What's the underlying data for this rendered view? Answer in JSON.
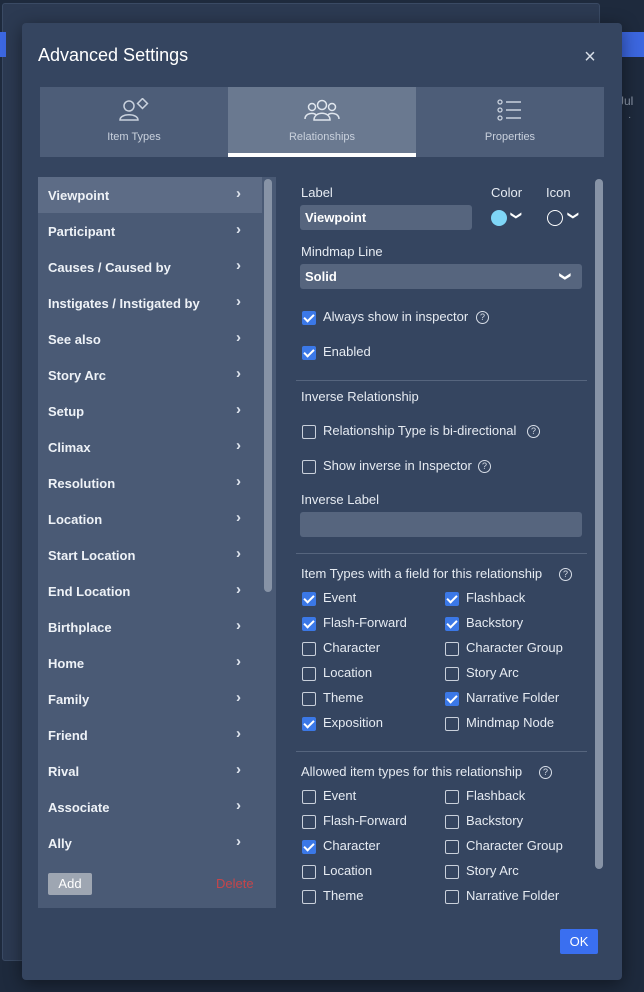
{
  "background": {
    "month_label": "Jul"
  },
  "dialog": {
    "title": "Advanced Settings",
    "close_symbol": "×"
  },
  "tabs": [
    {
      "label": "Item Types",
      "icon": "user-diamond-icon",
      "active": false
    },
    {
      "label": "Relationships",
      "icon": "users-group-icon",
      "active": true
    },
    {
      "label": "Properties",
      "icon": "list-icon",
      "active": false
    }
  ],
  "relationships": [
    "Viewpoint",
    "Participant",
    "Causes / Caused by",
    "Instigates / Instigated by",
    "See also",
    "Story Arc",
    "Setup",
    "Climax",
    "Resolution",
    "Location",
    "Start Location",
    "End Location",
    "Birthplace",
    "Home",
    "Family",
    "Friend",
    "Rival",
    "Associate",
    "Ally"
  ],
  "selected_relationship": "Viewpoint",
  "list_actions": {
    "add": "Add",
    "delete": "Delete"
  },
  "editor": {
    "label_heading": "Label",
    "label_value": "Viewpoint",
    "color_heading": "Color",
    "color_value": "#7fd6f7",
    "icon_heading": "Icon",
    "mindmap_heading": "Mindmap Line",
    "mindmap_value": "Solid",
    "always_show": {
      "label": "Always show in inspector",
      "checked": true
    },
    "enabled": {
      "label": "Enabled",
      "checked": true
    },
    "inverse_heading": "Inverse Relationship",
    "bidirectional": {
      "label": "Relationship Type is bi-directional",
      "checked": false
    },
    "show_inverse": {
      "label": "Show inverse in Inspector",
      "checked": false
    },
    "inverse_label_heading": "Inverse Label",
    "inverse_label_value": "",
    "field_types_heading": "Item Types with a field for this relationship",
    "field_types": [
      {
        "label": "Event",
        "checked": true
      },
      {
        "label": "Flashback",
        "checked": true
      },
      {
        "label": "Flash-Forward",
        "checked": true
      },
      {
        "label": "Backstory",
        "checked": true
      },
      {
        "label": "Character",
        "checked": false
      },
      {
        "label": "Character Group",
        "checked": false
      },
      {
        "label": "Location",
        "checked": false
      },
      {
        "label": "Story Arc",
        "checked": false
      },
      {
        "label": "Theme",
        "checked": false
      },
      {
        "label": "Narrative Folder",
        "checked": true
      },
      {
        "label": "Exposition",
        "checked": true
      },
      {
        "label": "Mindmap Node",
        "checked": false
      }
    ],
    "allowed_types_heading": "Allowed item types for this relationship",
    "allowed_types": [
      {
        "label": "Event",
        "checked": false
      },
      {
        "label": "Flashback",
        "checked": false
      },
      {
        "label": "Flash-Forward",
        "checked": false
      },
      {
        "label": "Backstory",
        "checked": false
      },
      {
        "label": "Character",
        "checked": true
      },
      {
        "label": "Character Group",
        "checked": false
      },
      {
        "label": "Location",
        "checked": false
      },
      {
        "label": "Story Arc",
        "checked": false
      },
      {
        "label": "Theme",
        "checked": false
      },
      {
        "label": "Narrative Folder",
        "checked": false
      }
    ]
  },
  "footer": {
    "ok": "OK"
  },
  "colors": {
    "accent": "#3a6ff0",
    "delete": "#c6454a",
    "checkbox": "#3b78e7"
  }
}
